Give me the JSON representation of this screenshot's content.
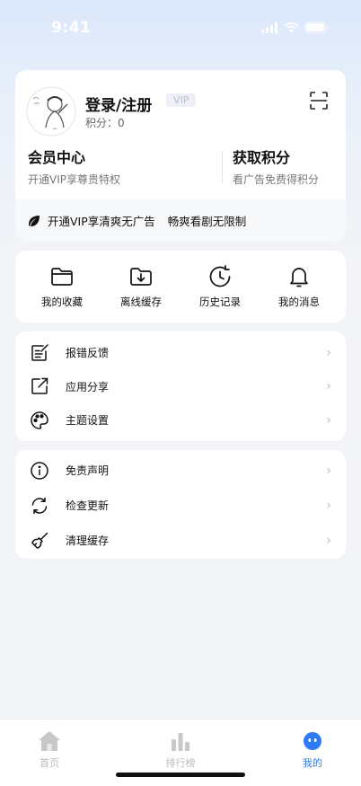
{
  "status_bar": {
    "time": "9:41"
  },
  "profile": {
    "name": "登录/注册",
    "vip_badge": "VIP",
    "points_label": "积分：",
    "points_value": "0",
    "member_center": {
      "title": "会员中心",
      "subtitle": "开通VIP享尊贵特权"
    },
    "get_points": {
      "title": "获取积分",
      "subtitle": "看广告免费得积分"
    },
    "banner": {
      "text1": "开通VIP享清爽无广告",
      "text2": "畅爽看剧无限制"
    }
  },
  "quick_actions": [
    {
      "label": "我的收藏",
      "icon": "folder-icon"
    },
    {
      "label": "离线缓存",
      "icon": "download-folder-icon"
    },
    {
      "label": "历史记录",
      "icon": "history-icon"
    },
    {
      "label": "我的消息",
      "icon": "bell-icon"
    }
  ],
  "menu_group_1": [
    {
      "label": "报错反馈",
      "icon": "feedback-edit-icon"
    },
    {
      "label": "应用分享",
      "icon": "share-icon"
    },
    {
      "label": "主题设置",
      "icon": "palette-icon"
    }
  ],
  "menu_group_2": [
    {
      "label": "免责声明",
      "icon": "info-icon"
    },
    {
      "label": "检查更新",
      "icon": "refresh-icon"
    },
    {
      "label": "清理缓存",
      "icon": "broom-icon"
    }
  ],
  "tab_bar": {
    "tabs": [
      {
        "label": "首页",
        "icon": "home-icon",
        "active": false
      },
      {
        "label": "排行榜",
        "icon": "bar-chart-icon",
        "active": false
      },
      {
        "label": "我的",
        "icon": "profile-face-icon",
        "active": true
      }
    ],
    "active_color": "#2f7bf5",
    "inactive_color": "#bbbbbb"
  }
}
